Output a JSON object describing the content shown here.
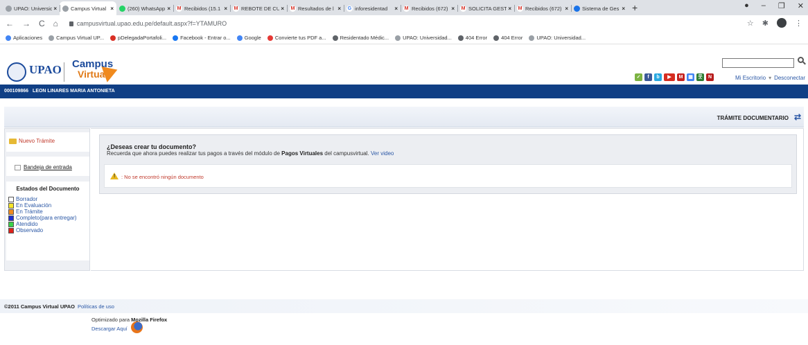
{
  "browser": {
    "tabs": [
      {
        "label": "UPAO: Universid",
        "color": "#9aa0a6",
        "glyph": "",
        "active": false
      },
      {
        "label": "Campus Virtual",
        "color": "#9aa0a6",
        "glyph": "",
        "active": true
      },
      {
        "label": "(260) WhatsApp",
        "color": "#25d366",
        "glyph": "",
        "active": false
      },
      {
        "label": "Recibidos (15.1",
        "color": "#ffffff",
        "glyph": "M",
        "active": false
      },
      {
        "label": "REBOTE DE CUE",
        "color": "#ffffff",
        "glyph": "M",
        "active": false
      },
      {
        "label": "Resultados de l",
        "color": "#ffffff",
        "glyph": "M",
        "active": false
      },
      {
        "label": "inforesidentad",
        "color": "#ffffff",
        "glyph": "G",
        "active": false
      },
      {
        "label": "Recibidos (672)",
        "color": "#ffffff",
        "glyph": "M",
        "active": false
      },
      {
        "label": "SOLICITA GESTI",
        "color": "#ffffff",
        "glyph": "M",
        "active": false
      },
      {
        "label": "Recibidos (672)",
        "color": "#ffffff",
        "glyph": "M",
        "active": false
      },
      {
        "label": "Sistema de Ges",
        "color": "#1a73e8",
        "glyph": "",
        "active": false
      }
    ],
    "url": "campusvirtual.upao.edu.pe/default.aspx?f=YTAMURO",
    "bookmarks": [
      {
        "label": "Aplicaciones",
        "color": "#4285f4"
      },
      {
        "label": "Campus Virtual UP...",
        "color": "#9aa0a6"
      },
      {
        "label": "pDelegadaPortafoli...",
        "color": "#d93025"
      },
      {
        "label": "Facebook - Entrar o...",
        "color": "#1877f2"
      },
      {
        "label": "Google",
        "color": "#4285f4"
      },
      {
        "label": "Convierte tus PDF a...",
        "color": "#e53935"
      },
      {
        "label": "Residentado Médic...",
        "color": "#5f6368"
      },
      {
        "label": "UPAO: Universidad...",
        "color": "#9aa0a6"
      },
      {
        "label": "404 Error",
        "color": "#5f6368"
      },
      {
        "label": "404 Error",
        "color": "#5f6368"
      },
      {
        "label": "UPAO: Universidad...",
        "color": "#9aa0a6"
      }
    ]
  },
  "header": {
    "logo_upao": "UPAO",
    "logo_campus": "Campus",
    "logo_virtual": "Virtual",
    "my_desk_link": "Mi Escritorio",
    "logout_link": "Desconectar"
  },
  "userbar": {
    "user_code": "000109866",
    "user_name": "LEON LINARES MARIA ANTONIETA"
  },
  "section": {
    "title": "TRÁMITE DOCUMENTARIO"
  },
  "left": {
    "new_procedure": "Nuevo Trámite",
    "inbox": "Bandeja de entrada",
    "states_title": "Estados del Documento",
    "states": [
      {
        "label": "Borrador",
        "color": "#ffffff"
      },
      {
        "label": "En Evaluación",
        "color": "#f5e52a"
      },
      {
        "label": "En Trámite",
        "color": "#f08a1e"
      },
      {
        "label": "Completo(para entregar)",
        "color": "#1c2fd0"
      },
      {
        "label": "Atendido",
        "color": "#3ad34a"
      },
      {
        "label": "Observado",
        "color": "#e0201a"
      }
    ]
  },
  "main": {
    "question": "¿Deseas crear tu documento?",
    "text_before": "Recuerda que ahora puedes realizar tus pagos a través del módulo de ",
    "text_bold": "Pagos Virtuales",
    "text_after": " del campusvirtual.",
    "video_link": "Ver video",
    "no_documents": ": No se encontró ningún documento"
  },
  "footer": {
    "copyright": "©2011 Campus Virtual UPAO",
    "policies_link": "Políticas de uso",
    "optimized_prefix": "Optimizado para ",
    "optimized_browser": "Mozilla Firefox",
    "download_link": "Descargar Aquí"
  }
}
